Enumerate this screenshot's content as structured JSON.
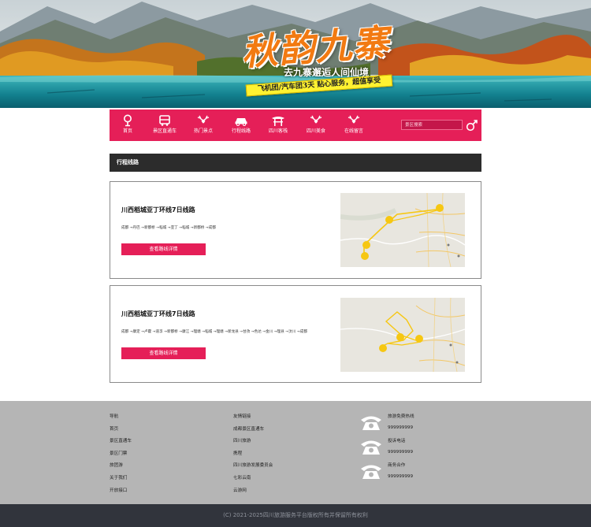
{
  "banner": {
    "title": "秋韵九寨",
    "subtitle": "去九寨邂逅人间仙境",
    "ribbon": "飞机团/汽车团3天  贴心服务，超值享受"
  },
  "nav": {
    "items": [
      {
        "label": "首页",
        "icon": "map-pin-icon"
      },
      {
        "label": "景区直通车",
        "icon": "bus-icon"
      },
      {
        "label": "热门景点",
        "icon": "deer-icon"
      },
      {
        "label": "行程线路",
        "icon": "car-icon"
      },
      {
        "label": "四川客栈",
        "icon": "pavilion-icon"
      },
      {
        "label": "四川美食",
        "icon": "deer-icon"
      },
      {
        "label": "在线留言",
        "icon": "deer-icon"
      }
    ],
    "search_placeholder": "景区搜索",
    "search_icon": "male-symbol-icon"
  },
  "section": {
    "title": "行程线路"
  },
  "routes": [
    {
      "title": "川西稻城亚丁环线7日线路",
      "stops": "成都 →丹巴 →新都桥 →稻城 →亚丁 →稻城 →新都桥 →成都",
      "button": "查看路线详情"
    },
    {
      "title": "川西稻城亚丁环线7日线路",
      "stops": "成都 →康定 →卢霍 →道孚 →新都桥 →康江 →理塘 →稻城 →理塘 →新龙县 →甘孜 →色达 →金川 →理县 →汶川 →成都",
      "button": "查看路线详情"
    }
  ],
  "footer": {
    "col1": [
      "导航",
      "首页",
      "景区直通车",
      "景区门票",
      "旅团游",
      "关于我们",
      "开放接口"
    ],
    "col2": [
      "友情链接",
      "成都景区直通车",
      "四川旅游",
      "携程",
      "四川旅游发展委员会",
      "七彩云南",
      "云游网"
    ],
    "contacts": [
      {
        "label": "旅游免费热线",
        "number": "999999999"
      },
      {
        "label": "投诉电话",
        "number": "999999999"
      },
      {
        "label": "商务合作",
        "number": "999999999"
      }
    ]
  },
  "copyright": "(C) 2021-2025四川旅游服务平台版权所有并保留所有权利",
  "colors": {
    "accent": "#e51f58",
    "section_header": "#2c2c2c",
    "footer_bg": "#b5b5b5",
    "copyright_bg": "#31343c"
  }
}
